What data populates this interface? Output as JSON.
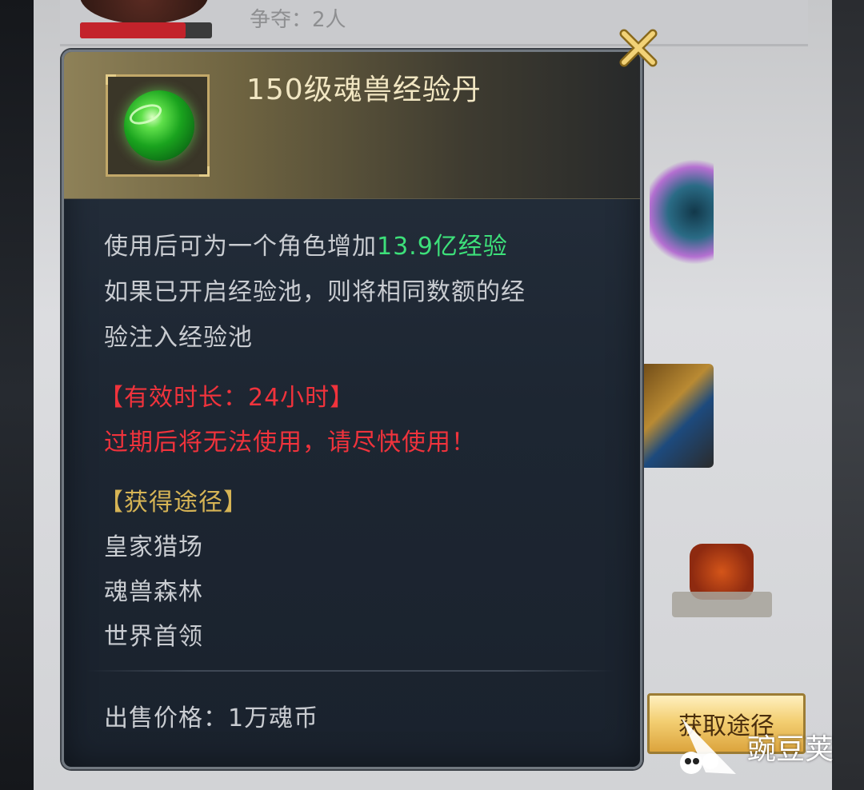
{
  "background": {
    "top_text": "争夺：2人"
  },
  "popup": {
    "item_name": "150级魂兽经验丹",
    "description": {
      "line1_prefix": "使用后可为一个角色增加",
      "line1_highlight": "13.9亿经验",
      "line2": "如果已开启经验池，则将相同数额的经",
      "line3": "验注入经验池"
    },
    "duration": {
      "label": "【有效时长：24小时】",
      "warning": "过期后将无法使用，请尽快使用！"
    },
    "sources": {
      "header": "【获得途径】",
      "items": [
        "皇家猎场",
        "魂兽森林",
        "世界首领"
      ]
    },
    "price": "出售价格：1万魂币"
  },
  "buttons": {
    "get_route": "获取途径"
  },
  "watermark": {
    "text": "豌豆荚"
  },
  "icons": {
    "close": "close-icon",
    "item": "green-orb-icon"
  },
  "colors": {
    "highlight_green": "#3de07a",
    "warning_red": "#f0333c",
    "source_gold": "#d6b455",
    "title": "#f1e6c2"
  }
}
